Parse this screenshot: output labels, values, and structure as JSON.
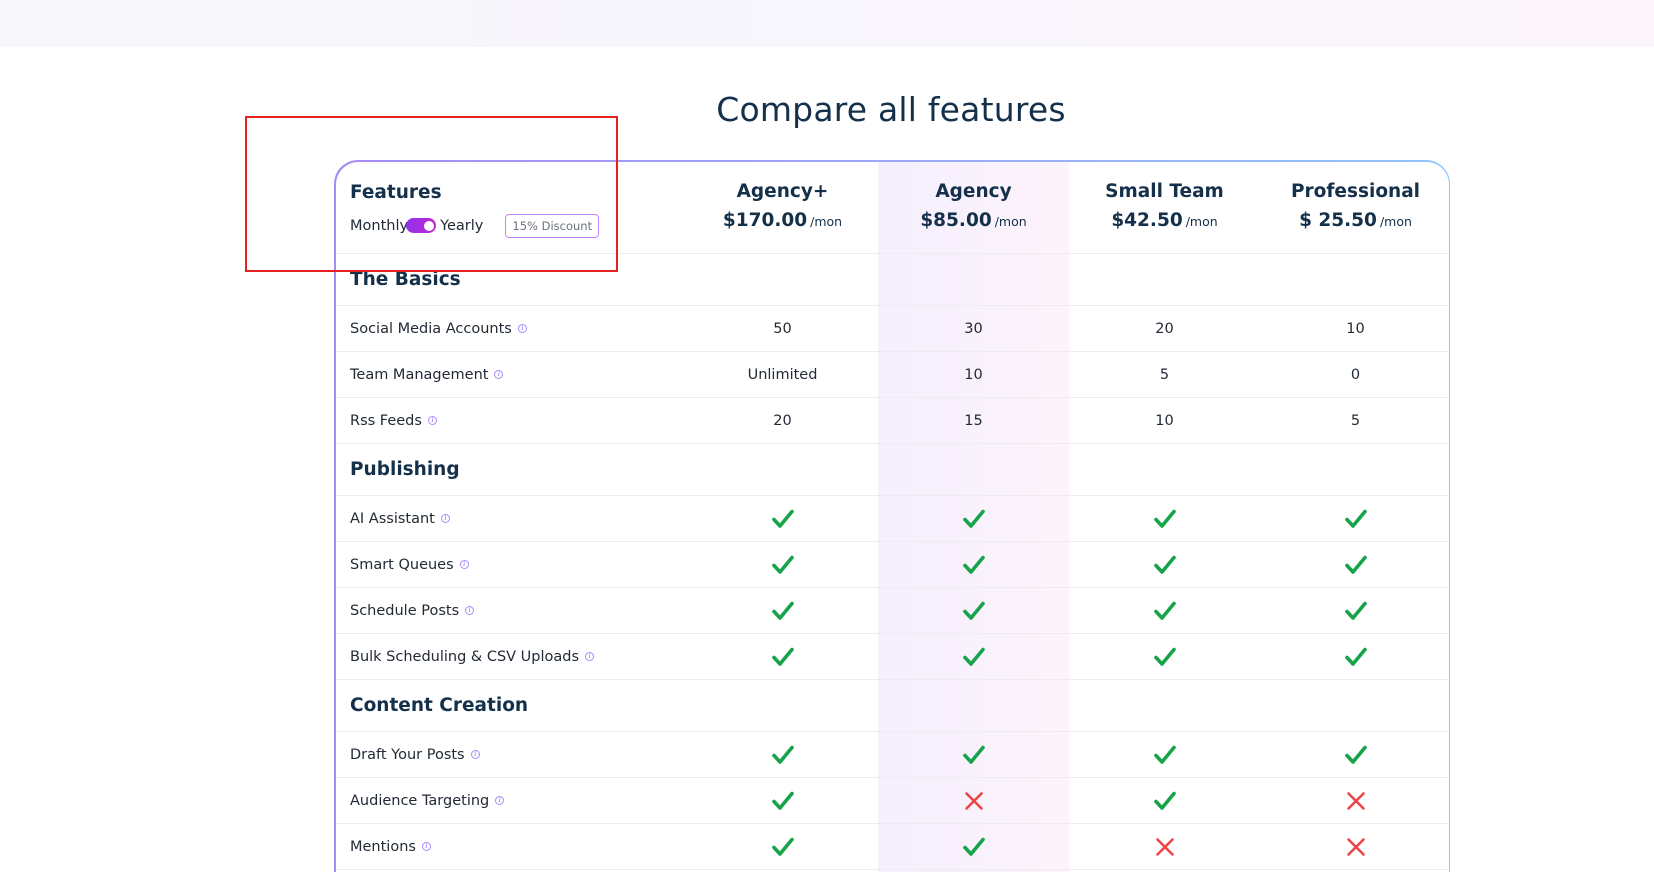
{
  "page": {
    "title": "Compare all features"
  },
  "header": {
    "features_label": "Features",
    "billing_toggle": {
      "left_label": "Monthly",
      "right_label": "Yearly",
      "selected": "Yearly"
    },
    "discount_badge": "15% Discount",
    "plans": [
      {
        "name": "Agency+",
        "price": "$170.00",
        "per": "/mon"
      },
      {
        "name": "Agency",
        "price": "$85.00",
        "per": "/mon"
      },
      {
        "name": "Small Team",
        "price": "$42.50",
        "per": "/mon"
      },
      {
        "name": "Professional",
        "price": "$ 25.50",
        "per": "/mon"
      }
    ]
  },
  "sections": [
    {
      "title": "The Basics",
      "rows": [
        {
          "label": "Social Media Accounts",
          "values": [
            "50",
            "30",
            "20",
            "10"
          ]
        },
        {
          "label": "Team Management",
          "values": [
            "Unlimited",
            "10",
            "5",
            "0"
          ]
        },
        {
          "label": "Rss Feeds",
          "values": [
            "20",
            "15",
            "10",
            "5"
          ]
        }
      ]
    },
    {
      "title": "Publishing",
      "rows": [
        {
          "label": "AI Assistant",
          "values": [
            "check",
            "check",
            "check",
            "check"
          ]
        },
        {
          "label": "Smart Queues",
          "values": [
            "check",
            "check",
            "check",
            "check"
          ]
        },
        {
          "label": "Schedule Posts",
          "values": [
            "check",
            "check",
            "check",
            "check"
          ]
        },
        {
          "label": "Bulk Scheduling & CSV Uploads",
          "values": [
            "check",
            "check",
            "check",
            "check"
          ]
        }
      ]
    },
    {
      "title": "Content Creation",
      "rows": [
        {
          "label": "Draft Your Posts",
          "values": [
            "check",
            "check",
            "check",
            "check"
          ]
        },
        {
          "label": "Audience Targeting",
          "values": [
            "check",
            "cross",
            "check",
            "cross"
          ]
        },
        {
          "label": "Mentions",
          "values": [
            "check",
            "check",
            "cross",
            "cross"
          ]
        }
      ]
    }
  ],
  "colors": {
    "check": "#16a34a",
    "cross": "#ef4444",
    "heading": "#14304a",
    "selection_box": "#e5201e"
  },
  "icons": {
    "info": "info-circle-icon",
    "check": "check-icon",
    "cross": "cross-icon"
  }
}
